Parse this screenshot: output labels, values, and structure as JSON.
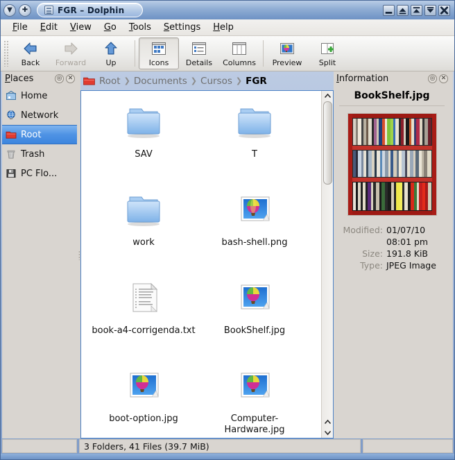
{
  "window": {
    "title": "FGR – Dolphin",
    "tab_icon": "dolphin-icon",
    "titlebar_buttons": [
      {
        "name": "menu-dropdown-button",
        "glyph": "▼"
      },
      {
        "name": "add-tab-button",
        "glyph": "✚"
      }
    ],
    "controls": [
      {
        "name": "minimize-button",
        "label": "Minimize"
      },
      {
        "name": "shade-button",
        "label": "Shade"
      },
      {
        "name": "maximize-button",
        "label": "Maximize"
      },
      {
        "name": "lower-button",
        "label": "Lower"
      },
      {
        "name": "close-button",
        "label": "Close"
      }
    ]
  },
  "menubar": [
    {
      "mnemonic": "F",
      "rest": "ile"
    },
    {
      "mnemonic": "E",
      "rest": "dit"
    },
    {
      "mnemonic": "V",
      "rest": "iew"
    },
    {
      "mnemonic": "G",
      "rest": "o"
    },
    {
      "mnemonic": "T",
      "rest": "ools"
    },
    {
      "mnemonic": "S",
      "rest": "ettings"
    },
    {
      "mnemonic": "H",
      "rest": "elp"
    }
  ],
  "toolbar": {
    "back_label": "Back",
    "forward_label": "Forward",
    "up_label": "Up",
    "icons_label": "Icons",
    "details_label": "Details",
    "columns_label": "Columns",
    "preview_label": "Preview",
    "split_label": "Split",
    "active_view": "Icons"
  },
  "places": {
    "title_mnemonic": "P",
    "title_rest": "laces",
    "lock_button": "lock-icon",
    "close_button": "close-icon",
    "items": [
      {
        "label": "Home",
        "icon": "home-icon",
        "selected": false
      },
      {
        "label": "Network",
        "icon": "network-icon",
        "selected": false
      },
      {
        "label": "Root",
        "icon": "root-folder-icon",
        "selected": true
      },
      {
        "label": "Trash",
        "icon": "trash-icon",
        "selected": false
      },
      {
        "label": "PC Flo...",
        "icon": "floppy-icon",
        "selected": false
      }
    ]
  },
  "breadcrumb": {
    "crumbs": [
      "Root",
      "Documents",
      "Cursos",
      "FGR"
    ],
    "current_index": 3,
    "separator": "❯"
  },
  "files": [
    {
      "name": "SAV",
      "type": "folder"
    },
    {
      "name": "T",
      "type": "folder"
    },
    {
      "name": "work",
      "type": "folder"
    },
    {
      "name": "bash-shell.png",
      "type": "image"
    },
    {
      "name": "book-a4-corrigenda.txt",
      "type": "text"
    },
    {
      "name": "BookShelf.jpg",
      "type": "image"
    },
    {
      "name": "boot-option.jpg",
      "type": "image"
    },
    {
      "name": "Computer-Hardware.jpg",
      "type": "image"
    }
  ],
  "info": {
    "title_mnemonic": "I",
    "title_rest": "nformation",
    "lock_button": "lock-icon",
    "close_button": "close-icon",
    "filename": "BookShelf.jpg",
    "preview_alt": "bookshelf-thumbnail",
    "fields": [
      {
        "key": "Modified:",
        "value": "01/07/10"
      },
      {
        "key": "",
        "value": "08:01 pm"
      },
      {
        "key": "Size:",
        "value": "191.8 KiB"
      },
      {
        "key": "Type:",
        "value": "JPEG Image"
      }
    ]
  },
  "statusbar": {
    "text": "3 Folders, 41 Files (39.7 MiB)"
  },
  "colors": {
    "selection": "#4f93e4",
    "titlebar": "#8fadd4",
    "panel": "#d9d5d0",
    "view_border": "#4d82c6",
    "folder_blue": "#9ec6f0",
    "root_red": "#e23b30"
  }
}
